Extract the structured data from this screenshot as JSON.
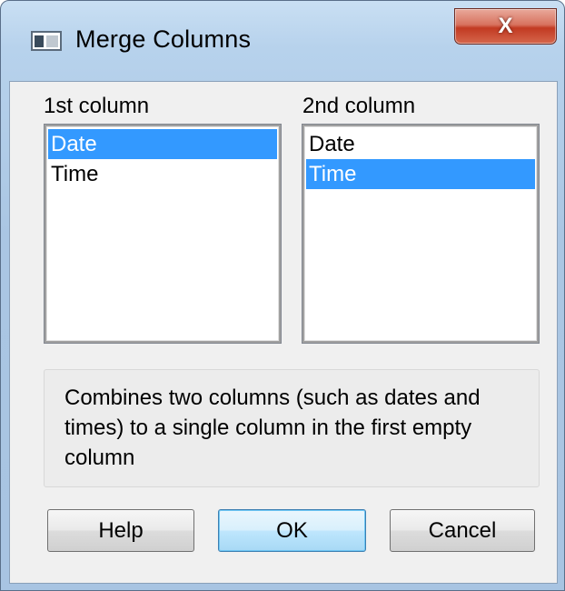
{
  "window": {
    "title": "Merge Columns",
    "close_label": "X"
  },
  "first_column": {
    "label": "1st column",
    "items": [
      {
        "label": "Date",
        "selected": true
      },
      {
        "label": "Time",
        "selected": false
      }
    ]
  },
  "second_column": {
    "label": "2nd column",
    "items": [
      {
        "label": "Date",
        "selected": false
      },
      {
        "label": "Time",
        "selected": true
      }
    ]
  },
  "description": "Combines two columns (such as dates and times) to a single column in the first empty column",
  "buttons": {
    "help": "Help",
    "ok": "OK",
    "cancel": "Cancel"
  },
  "colors": {
    "selection": "#3399ff",
    "title_bar": "#b7d2ec",
    "close_button": "#c23a22"
  }
}
